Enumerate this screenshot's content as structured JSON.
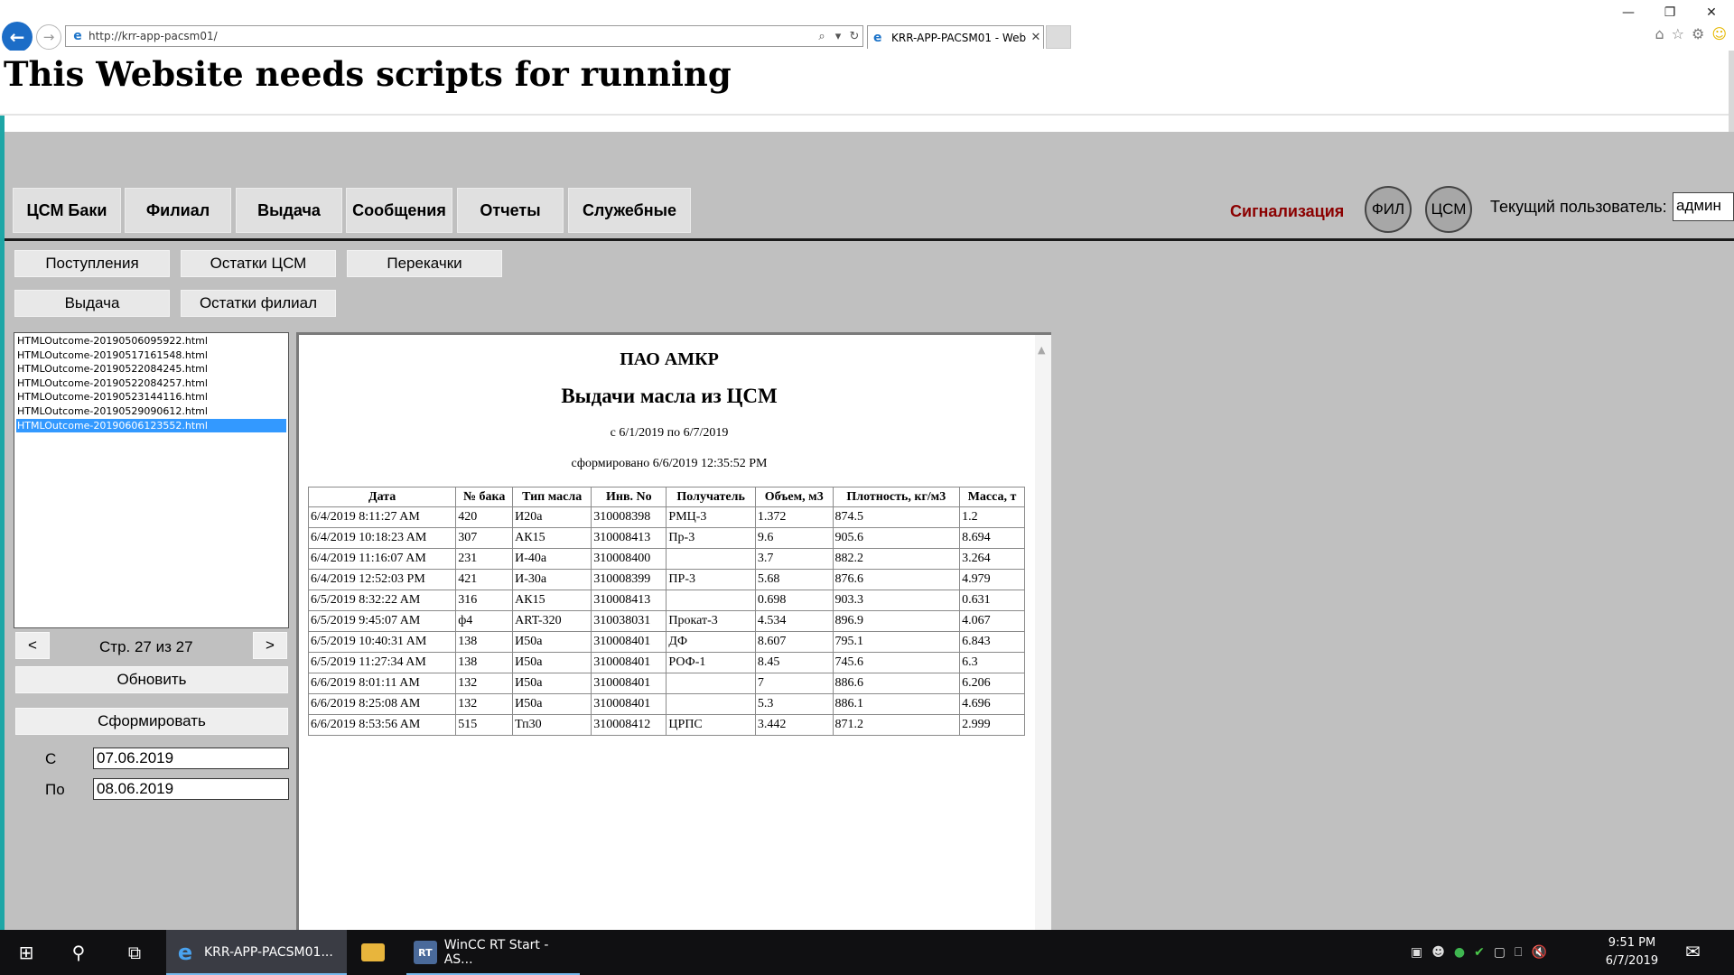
{
  "browser": {
    "url": "http://krr-app-pacsm01/",
    "tab_title": "KRR-APP-PACSM01 - Web ...",
    "window_controls": [
      "—",
      "❐",
      "✕"
    ],
    "icons": [
      "home-icon",
      "favorites-star-icon",
      "settings-gear-icon",
      "smiley-icon"
    ]
  },
  "page": {
    "script_message": "This Website needs scripts for running"
  },
  "app": {
    "menu": [
      "ЦСМ Баки",
      "Филиал",
      "Выдача",
      "Сообщения",
      "Отчеты",
      "Служебные"
    ],
    "alarm_label": "Сигнализация",
    "circle_buttons": [
      "ФИЛ",
      "ЦСМ"
    ],
    "user_label": "Текущий пользователь:",
    "user_value": "админ",
    "submenu": [
      "Поступления",
      "Остатки ЦСМ",
      "Перекачки",
      "Выдача",
      "Остатки филиал"
    ],
    "files": [
      "HTMLOutcome-20190506095922.html",
      "HTMLOutcome-20190517161548.html",
      "HTMLOutcome-20190522084245.html",
      "HTMLOutcome-20190522084257.html",
      "HTMLOutcome-20190523144116.html",
      "HTMLOutcome-20190529090612.html",
      "HTMLOutcome-20190606123552.html"
    ],
    "selected_file_index": 6,
    "pager": {
      "prev": "<",
      "next": ">",
      "label": "Стр. 27 из 27"
    },
    "refresh_label": "Обновить",
    "generate_label": "Сформировать",
    "date_from_label": "С",
    "date_from": "07.06.2019",
    "date_to_label": "По",
    "date_to": "08.06.2019"
  },
  "report": {
    "org": "ПАО АМКР",
    "title": "Выдачи масла из ЦСМ",
    "period": "с 6/1/2019 по 6/7/2019",
    "generated": "сформировано 6/6/2019 12:35:52 PM",
    "columns": [
      "Дата",
      "№ бака",
      "Тип масла",
      "Инв. No",
      "Получатель",
      "Объем, м3",
      "Плотность, кг/м3",
      "Масса, т"
    ],
    "rows": [
      [
        "6/4/2019 8:11:27 AM",
        "420",
        "И20а",
        "310008398",
        "РМЦ-3",
        "1.372",
        "874.5",
        "1.2"
      ],
      [
        "6/4/2019 10:18:23 AM",
        "307",
        "АК15",
        "310008413",
        "Пр-3",
        "9.6",
        "905.6",
        "8.694"
      ],
      [
        "6/4/2019 11:16:07 AM",
        "231",
        "И-40а",
        "310008400",
        "",
        "3.7",
        "882.2",
        "3.264"
      ],
      [
        "6/4/2019 12:52:03 PM",
        "421",
        "И-30а",
        "310008399",
        "ПР-3",
        "5.68",
        "876.6",
        "4.979"
      ],
      [
        "6/5/2019 8:32:22 AM",
        "316",
        "АК15",
        "310008413",
        "",
        "0.698",
        "903.3",
        "0.631"
      ],
      [
        "6/5/2019 9:45:07 AM",
        "ф4",
        "ART-320",
        "310038031",
        "Прокат-3",
        "4.534",
        "896.9",
        "4.067"
      ],
      [
        "6/5/2019 10:40:31 AM",
        "138",
        "И50а",
        "310008401",
        "ДФ",
        "8.607",
        "795.1",
        "6.843"
      ],
      [
        "6/5/2019 11:27:34 AM",
        "138",
        "И50а",
        "310008401",
        "РОФ-1",
        "8.45",
        "745.6",
        "6.3"
      ],
      [
        "6/6/2019 8:01:11 AM",
        "132",
        "И50а",
        "310008401",
        "",
        "7",
        "886.6",
        "6.206"
      ],
      [
        "6/6/2019 8:25:08 AM",
        "132",
        "И50а",
        "310008401",
        "",
        "5.3",
        "886.1",
        "4.696"
      ],
      [
        "6/6/2019 8:53:56 AM",
        "515",
        "Тп30",
        "310008412",
        "ЦРПС",
        "3.442",
        "871.2",
        "2.999"
      ]
    ]
  },
  "taskbar": {
    "apps": [
      {
        "icon": "internet-explorer-icon",
        "label": "KRR-APP-PACSM01..."
      },
      {
        "icon": "file-explorer-icon",
        "label": ""
      },
      {
        "icon": "wincc-icon",
        "label": "WinCC RT Start - AS..."
      }
    ],
    "time": "9:51 PM",
    "date": "6/7/2019",
    "notification_count": "1"
  },
  "colors": {
    "app_background": "#c0c0c0",
    "alarm_text": "#8b0000",
    "selection": "#3399ff",
    "accent_strip": "#1ea6a6",
    "taskbar": "#101012"
  }
}
